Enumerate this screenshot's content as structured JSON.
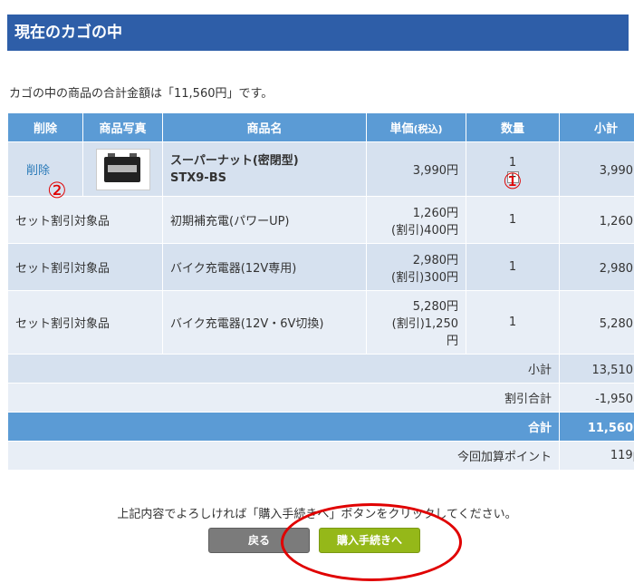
{
  "header": {
    "title": "現在のカゴの中"
  },
  "summary_message": "カゴの中の商品の合計金額は「11,560円」です。",
  "table": {
    "headers": {
      "delete": "削除",
      "photo": "商品写真",
      "name": "商品名",
      "price": "単価",
      "price_suffix": "(税込)",
      "qty": "数量",
      "subtotal": "小計"
    },
    "main_item": {
      "delete_label": "削除",
      "name_line1": "スーパーナット(密閉型)",
      "name_line2": "STX9-BS",
      "price": "3,990円",
      "qty": "1",
      "plus_icon": "+",
      "subtotal": "3,990円"
    },
    "set_items": [
      {
        "label": "セット割引対象品",
        "name": "初期補充電(パワーUP)",
        "price": "1,260円",
        "discount": "(割引)400円",
        "qty": "1",
        "subtotal": "1,260円"
      },
      {
        "label": "セット割引対象品",
        "name": "バイク充電器(12V専用)",
        "price": "2,980円",
        "discount": "(割引)300円",
        "qty": "1",
        "subtotal": "2,980円"
      },
      {
        "label": "セット割引対象品",
        "name": "バイク充電器(12V・6V切換)",
        "price": "5,280円",
        "discount": "(割引)1,250",
        "discount_unit": "円",
        "qty": "1",
        "subtotal": "5,280円"
      }
    ],
    "totals": {
      "subtotal_label": "小計",
      "subtotal_value": "13,510円",
      "discount_label": "割引合計",
      "discount_value": "-1,950円",
      "total_label": "合計",
      "total_value": "11,560円",
      "points_label": "今回加算ポイント",
      "points_value": "119pt"
    }
  },
  "annotations": {
    "one": "①",
    "two": "②"
  },
  "bottom_message": "上記内容でよろしければ「購入手続きへ」ボタンをクリックしてください。",
  "buttons": {
    "back": "戻る",
    "checkout": "購入手続きへ"
  },
  "colors": {
    "header_bg": "#2e5ea8",
    "table_header_bg": "#5b9bd5",
    "checkout_btn": "#95b819",
    "back_btn": "#7b7b7b",
    "annotation": "#e00000"
  }
}
